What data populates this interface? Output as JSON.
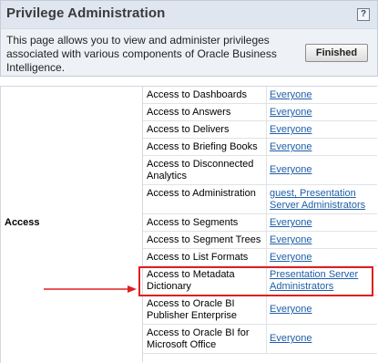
{
  "header": {
    "title": "Privilege Administration",
    "help_icon": "help-icon"
  },
  "description": {
    "text": "This page allows you to view and administer privileges associated with various components of Oracle Business Intelligence.",
    "finished_label": "Finished"
  },
  "table": {
    "group_label": "Access",
    "rows": [
      {
        "privilege": "Access to Dashboards",
        "assigned": "Everyone"
      },
      {
        "privilege": "Access to Answers",
        "assigned": "Everyone"
      },
      {
        "privilege": "Access to Delivers",
        "assigned": "Everyone"
      },
      {
        "privilege": "Access to Briefing Books",
        "assigned": "Everyone"
      },
      {
        "privilege": "Access to Disconnected Analytics",
        "assigned": "Everyone"
      },
      {
        "privilege": "Access to Administration",
        "assigned": "guest, Presentation Server Administrators"
      },
      {
        "privilege": "Access to Segments",
        "assigned": "Everyone"
      },
      {
        "privilege": "Access to Segment Trees",
        "assigned": "Everyone"
      },
      {
        "privilege": "Access to List Formats",
        "assigned": "Everyone"
      },
      {
        "privilege": "Access to Metadata Dictionary",
        "assigned": "Presentation Server Administrators"
      },
      {
        "privilege": "Access to Oracle BI Publisher Enterprise",
        "assigned": "Everyone"
      },
      {
        "privilege": "Access to Oracle BI for Microsoft Office",
        "assigned": "Everyone"
      }
    ]
  },
  "annotation": {
    "highlight_color": "#e0201e",
    "highlighted_row_index": 9
  }
}
